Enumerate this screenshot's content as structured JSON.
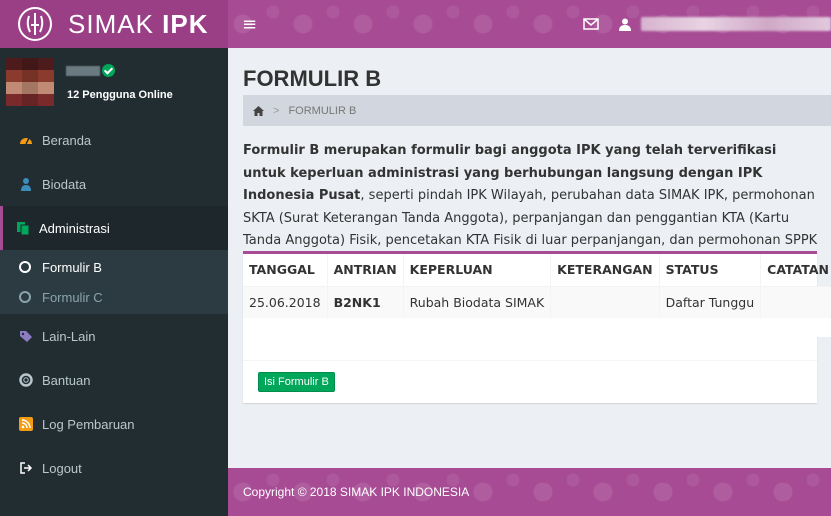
{
  "app": {
    "name_light": "SIMAK ",
    "name_bold": "IPK"
  },
  "header": {
    "menu_toggle": "≡"
  },
  "sidebar": {
    "online_text": "12 Pengguna Online",
    "items": [
      {
        "label": "Beranda",
        "icon": "dashboard-icon"
      },
      {
        "label": "Biodata",
        "icon": "user-icon"
      },
      {
        "label": "Administrasi",
        "icon": "files-icon"
      },
      {
        "label": "Lain-Lain",
        "icon": "tag-icon"
      },
      {
        "label": "Bantuan",
        "icon": "life-ring-icon"
      },
      {
        "label": "Log Pembaruan",
        "icon": "rss-icon"
      },
      {
        "label": "Logout",
        "icon": "sign-out-icon"
      }
    ],
    "submenu": [
      {
        "label": "Formulir B"
      },
      {
        "label": "Formulir C"
      }
    ]
  },
  "page": {
    "title": "FORMULIR B",
    "breadcrumb_current": "FORMULIR B",
    "desc_bold": "Formulir B merupakan formulir bagi anggota IPK yang telah terverifikasi untuk keperluan administrasi yang berhubungan langsung dengan IPK Indonesia Pusat",
    "desc_rest": ", seperti pindah IPK Wilayah, perubahan data SIMAK IPK, permohonan SKTA (Surat Keterangan Tanda Anggota), perpanjangan dan penggantian KTA (Kartu Tanda Anggota) Fisik, pencetakan KTA Fisik di luar perpanjangan, dan permohonan SPPK (Sertifikat Pengukuhan Psikolog Klinis)."
  },
  "table": {
    "headers": [
      "TANGGAL",
      "ANTRIAN",
      "KEPERLUAN",
      "KETERANGAN",
      "STATUS",
      "CATATAN"
    ],
    "rows": [
      [
        "25.06.2018",
        "B2NK1",
        "Rubah Biodata SIMAK",
        "",
        "Daftar Tunggu",
        ""
      ]
    ]
  },
  "button": {
    "label": "Isi Formulir B"
  },
  "footer": {
    "text": "Copyright © 2018 SIMAK IPK INDONESIA"
  },
  "colors": {
    "brand": "#a74b94",
    "sidebar": "#222d32",
    "success": "#00a65a"
  }
}
